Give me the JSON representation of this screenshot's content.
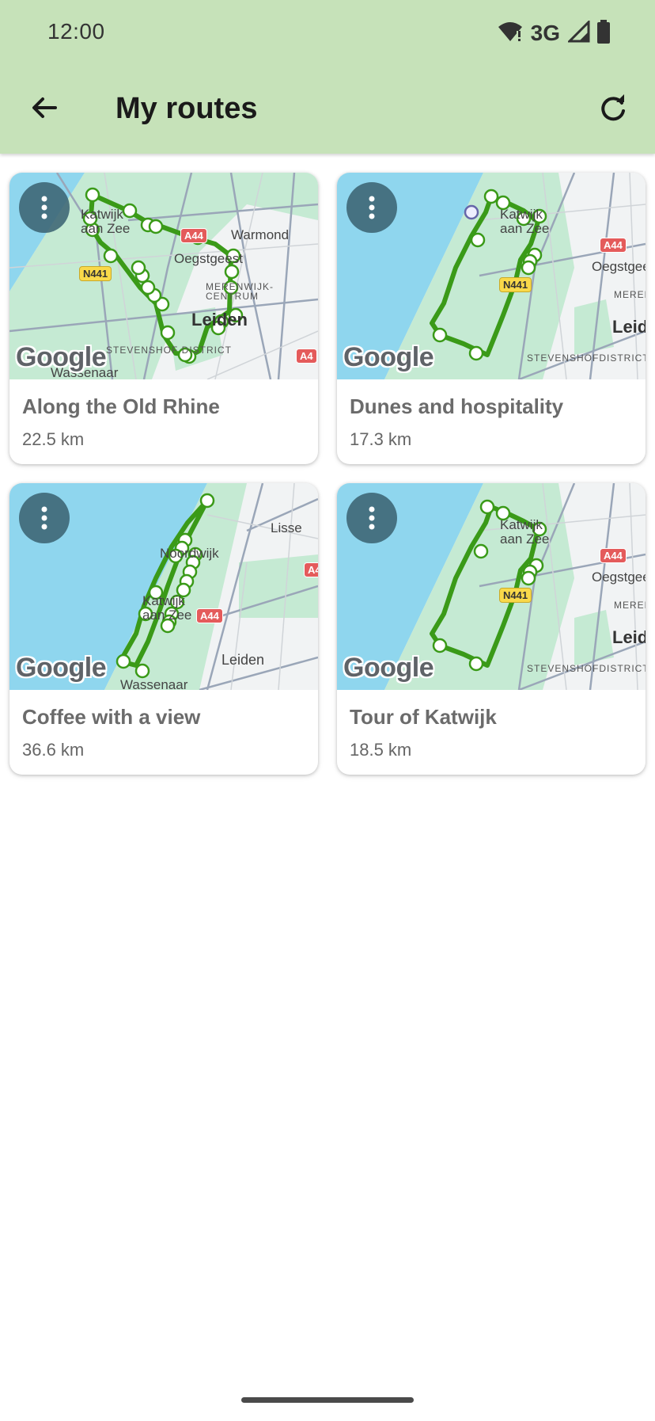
{
  "status_bar": {
    "time": "12:00",
    "network": "3G"
  },
  "app_bar": {
    "title": "My routes"
  },
  "colors": {
    "app_bar": "#c6e2b9",
    "route": "#3a9a18",
    "water": "#8fd6ee",
    "land": "#bfe7cf"
  },
  "routes": [
    {
      "name": "Along the Old Rhine",
      "distance": "22.5 km",
      "map_labels": {
        "l1": "Katwijk",
        "l2": "aan Zee",
        "l3": "Warmond",
        "l4": "Oegstgeest",
        "l5": "MERENWIJK-CENTRUM",
        "l6": "Leiden",
        "l7": "STEVENSHOF DISTRICT",
        "l8": "Wassenaar",
        "b1": "N441",
        "b2": "A44",
        "b3": "A4"
      }
    },
    {
      "name": "Dunes and hospitality",
      "distance": "17.3 km",
      "map_labels": {
        "l1": "Katwijk",
        "l2": "aan Zee",
        "l3": "Oegstgeest",
        "l4": "MERENWIJK",
        "l5": "Leiden",
        "l6": "STEVENSHOFDISTRICT",
        "b1": "N441",
        "b2": "A44"
      }
    },
    {
      "name": "Coffee with a view",
      "distance": "36.6 km",
      "map_labels": {
        "l1": "Lisse",
        "l2": "Noordwijk",
        "l3": "Katwijk",
        "l4": "aan Zee",
        "l5": "Leiden",
        "l6": "Wassenaar",
        "b1": "A44",
        "b2": "A4"
      }
    },
    {
      "name": "Tour of Katwijk",
      "distance": "18.5 km",
      "map_labels": {
        "l1": "Katwijk",
        "l2": "aan Zee",
        "l3": "Oegstgeest",
        "l4": "MERENWIJK",
        "l5": "Leiden",
        "l6": "STEVENSHOFDISTRICT",
        "b1": "N441",
        "b2": "A44"
      }
    }
  ],
  "map_attribution": "Google"
}
